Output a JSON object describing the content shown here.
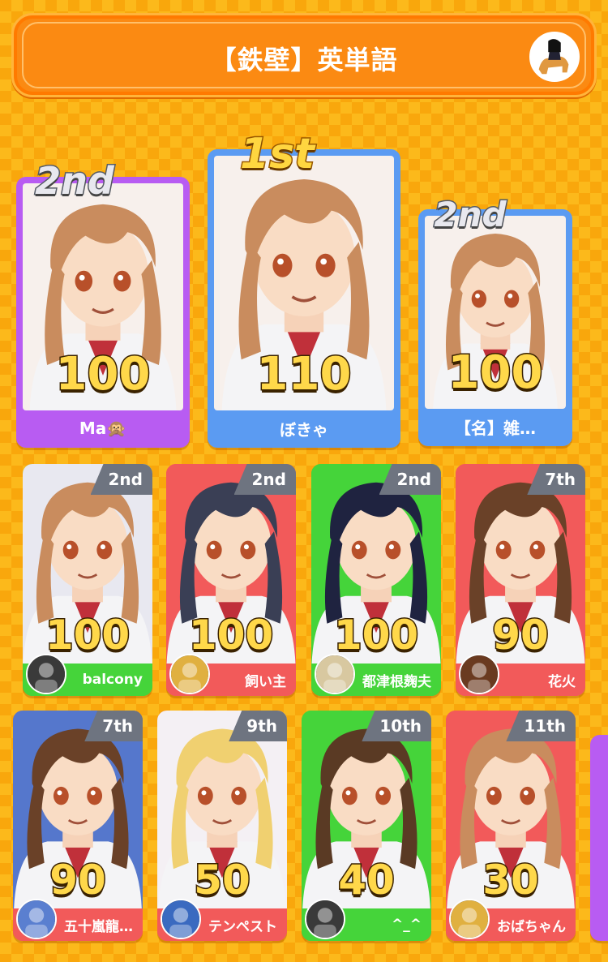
{
  "header": {
    "title": "【鉄壁】英単語",
    "avatar_icon": "horse-rider-avatar"
  },
  "top3": [
    {
      "rank": "2nd",
      "score": "100",
      "name": "Ma🙊",
      "color": "#b85cf2",
      "hair": "#c98c5e"
    },
    {
      "rank": "1st",
      "score": "110",
      "name": "ぼきゃ",
      "color": "#5b9bf2",
      "hair": "#c98c5e"
    },
    {
      "rank": "2nd",
      "score": "100",
      "name": "【名】雑…",
      "color": "#5b9bf2",
      "hair": "#c98c5e"
    }
  ],
  "row2": [
    {
      "rank": "2nd",
      "score": "100",
      "name": "balcony",
      "color": "#45d43a",
      "hair": "#c98c5e",
      "bg": "#e8e8f0"
    },
    {
      "rank": "2nd",
      "score": "100",
      "name": "飼い主",
      "color": "#f25a5a",
      "hair": "#3a3f55",
      "bg": "#f25a5a"
    },
    {
      "rank": "2nd",
      "score": "100",
      "name": "都津根麹夫",
      "color": "#45d43a",
      "hair": "#1f2340",
      "bg": "#45d43a"
    },
    {
      "rank": "7th",
      "score": "90",
      "name": "花火",
      "color": "#f25a5a",
      "hair": "#6a4128",
      "bg": "#f25a5a"
    }
  ],
  "row3": [
    {
      "rank": "7th",
      "score": "90",
      "name": "五十嵐龍…",
      "color": "#f25a5a",
      "hair": "#6a4128",
      "bg": "#5577cc"
    },
    {
      "rank": "9th",
      "score": "50",
      "name": "テンペスト",
      "color": "#f25a5a",
      "hair": "#f0d070",
      "bg": "#f4f0f4"
    },
    {
      "rank": "10th",
      "score": "40",
      "name": "^_^",
      "color": "#45d43a",
      "hair": "#5a3a24",
      "bg": "#45d43a"
    },
    {
      "rank": "11th",
      "score": "30",
      "name": "おばちゃん",
      "color": "#f25a5a",
      "hair": "#c98c5e",
      "bg": "#f25a5a"
    }
  ]
}
